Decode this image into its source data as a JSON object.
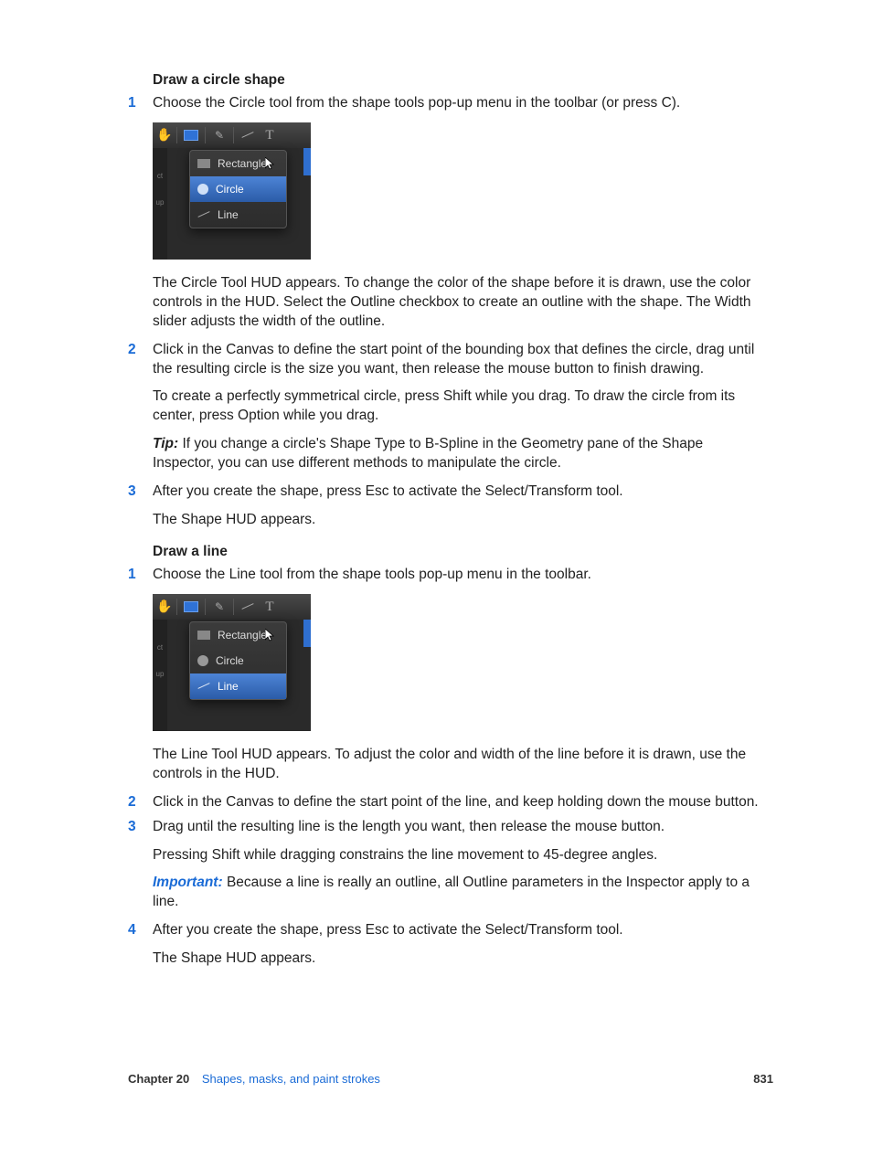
{
  "section1": {
    "title": "Draw a circle shape",
    "step1": "Choose the Circle tool from the shape tools pop-up menu in the toolbar (or press C).",
    "p1": "The Circle Tool HUD appears. To change the color of the shape before it is drawn, use the color controls in the HUD. Select the Outline checkbox to create an outline with the shape. The Width slider adjusts the width of the outline.",
    "step2": "Click in the Canvas to define the start point of the bounding box that defines the circle, drag until the resulting circle is the size you want, then release the mouse button to finish drawing.",
    "p2": "To create a perfectly symmetrical circle, press Shift while you drag. To draw the circle from its center, press Option while you drag.",
    "tip_label": "Tip:  ",
    "tip": "If you change a circle's Shape Type to B-Spline in the Geometry pane of the Shape Inspector, you can use different methods to manipulate the circle.",
    "step3": "After you create the shape, press Esc to activate the Select/Transform tool.",
    "p3": "The Shape HUD appears."
  },
  "section2": {
    "title": "Draw a line",
    "step1": "Choose the Line tool from the shape tools pop-up menu in the toolbar.",
    "p1": "The Line Tool HUD appears. To adjust the color and width of the line before it is drawn, use the controls in the HUD.",
    "step2": "Click in the Canvas to define the start point of the line, and keep holding down the mouse button.",
    "step3": " Drag until the resulting line is the length you want, then release the mouse button.",
    "p2": "Pressing Shift while dragging constrains the line movement to 45-degree angles.",
    "imp_label": "Important:  ",
    "imp": "Because a line is really an outline, all Outline parameters in the Inspector apply to a line.",
    "step4": "After you create the shape, press Esc to activate the Select/Transform tool.",
    "p3": "The Shape HUD appears."
  },
  "menu": {
    "rectangle": "Rectangle",
    "circle": "Circle",
    "line": "Line"
  },
  "ui_left": {
    "a": "ct",
    "b": "up"
  },
  "footer": {
    "chapter": "Chapter 20",
    "link": "Shapes, masks, and paint strokes",
    "page": "831"
  }
}
